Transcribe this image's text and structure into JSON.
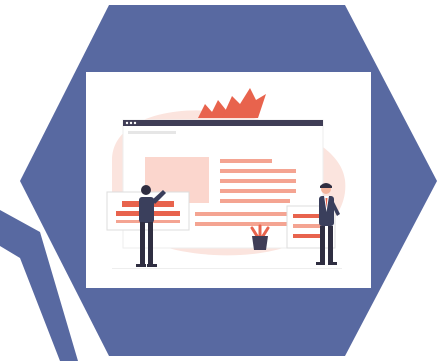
{
  "colors": {
    "hexagon": "#5869a1",
    "card_background": "#ffffff",
    "blush": "#fbe4de",
    "accent": "#e8634d",
    "accent_light": "#f4a492",
    "browser_bar": "#3f3d56",
    "suit_dark": "#3a3f5c"
  },
  "icons": [
    "hexagon-background",
    "web-design-illustration",
    "plant-pot-icon",
    "maple-leaf-decoration"
  ]
}
